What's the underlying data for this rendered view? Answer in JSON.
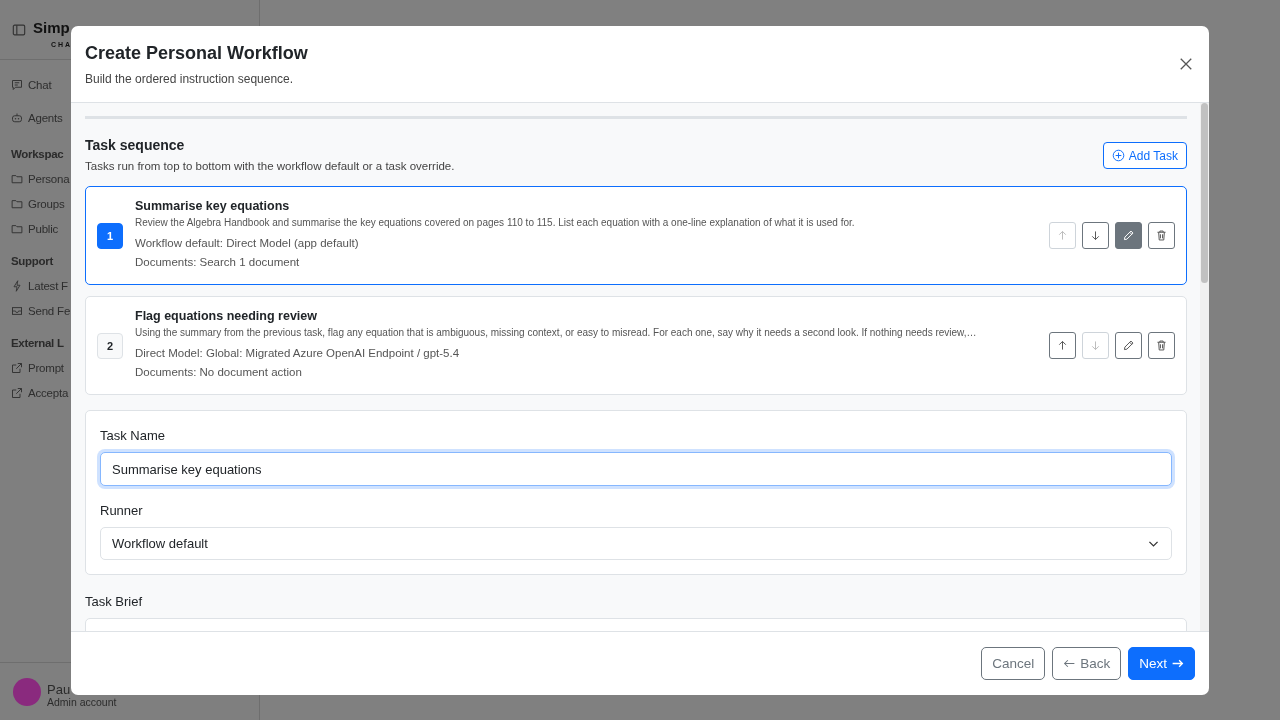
{
  "sidebar": {
    "logo": {
      "name": "Simp",
      "tagline": "CHA"
    },
    "nav": [
      {
        "label": "Chat"
      },
      {
        "label": "Agents"
      }
    ],
    "sections": [
      {
        "title": "Workspac",
        "items": [
          {
            "label": "Persona"
          },
          {
            "label": "Groups"
          },
          {
            "label": "Public"
          }
        ]
      },
      {
        "title": "Support",
        "items": [
          {
            "label": "Latest F"
          },
          {
            "label": "Send Fe"
          }
        ]
      },
      {
        "title": "External L",
        "items": [
          {
            "label": "Prompt"
          },
          {
            "label": "Accepta"
          }
        ]
      }
    ],
    "user": {
      "name": "Pau",
      "role": "Admin account"
    }
  },
  "dialog": {
    "title": "Create Personal Workflow",
    "subtitle": "Build the ordered instruction sequence.",
    "section_title": "Task sequence",
    "section_hint": "Tasks run from top to bottom with the workflow default or a task override.",
    "add_button": "Add Task",
    "tasks": [
      {
        "number": "1",
        "title": "Summarise key equations",
        "description": "Review the Algebra Handbook and summarise the key equations covered on pages 110 to 115. List each equation with a one-line explanation of what it is used for.",
        "runner": "Workflow default: Direct Model (app default)",
        "documents": "Documents: Search 1 document",
        "selected": true,
        "can_move_up": false,
        "can_move_down": true
      },
      {
        "number": "2",
        "title": "Flag equations needing review",
        "description": "Using the summary from the previous task, flag any equation that is ambiguous, missing context, or easy to misread. For each one, say why it needs a second look. If nothing needs review,…",
        "runner": "Direct Model: Global: Migrated Azure OpenAI Endpoint / gpt-5.4",
        "documents": "Documents: No document action",
        "selected": false,
        "can_move_up": true,
        "can_move_down": false
      }
    ],
    "form": {
      "fields": [
        {
          "label": "Task Name",
          "kind": "text",
          "value": "Summarise key equations",
          "focused": true
        },
        {
          "label": "Runner",
          "kind": "select",
          "value": "Workflow default",
          "focused": false
        }
      ],
      "brief_label": "Task Brief"
    },
    "buttons": [
      {
        "label": "Cancel",
        "kind": "secondary"
      },
      {
        "label": "Back",
        "kind": "back"
      },
      {
        "label": "Next",
        "kind": "primary"
      }
    ]
  }
}
